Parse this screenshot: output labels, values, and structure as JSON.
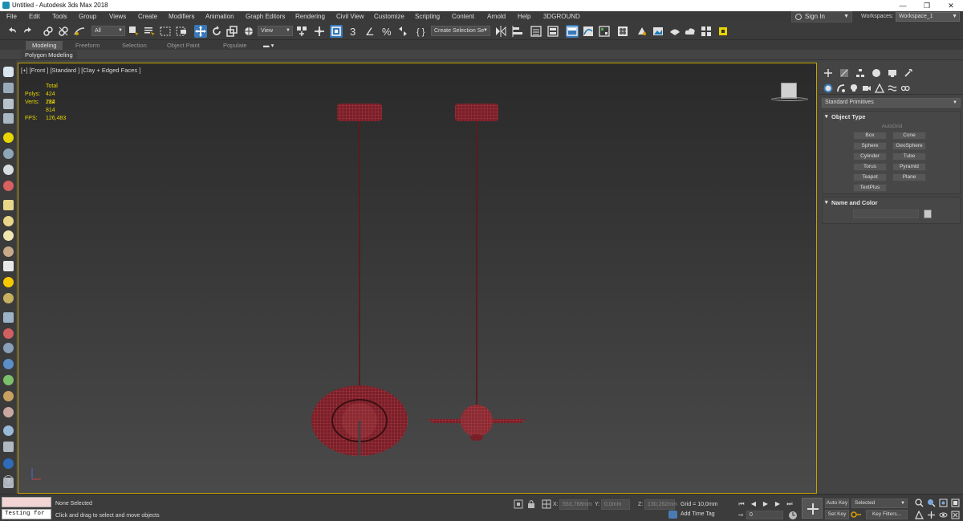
{
  "window": {
    "title": "Untitled - Autodesk 3ds Max 2018",
    "minimize": "—",
    "restore": "❐",
    "close": "✕"
  },
  "menu": [
    "File",
    "Edit",
    "Tools",
    "Group",
    "Views",
    "Create",
    "Modifiers",
    "Animation",
    "Graph Editors",
    "Rendering",
    "Civil View",
    "Customize",
    "Scripting",
    "Content",
    "Arnold",
    "Help",
    "3DGROUND"
  ],
  "account": {
    "sign_in": "Sign In",
    "workspaces_label": "Workspaces:",
    "workspace": "Workspace_1"
  },
  "toolbar": {
    "selection_filter": "All",
    "reference_coord": "View",
    "named_selection": "Create Selection Se",
    "snap_label": "3",
    "angle_snap": "∠",
    "percent_snap": "%"
  },
  "ribbon": {
    "tabs": [
      "Modeling",
      "Freeform",
      "Selection",
      "Object Paint",
      "Populate"
    ],
    "active_tab": "Modeling",
    "panel_label": "Polygon Modeling"
  },
  "viewport": {
    "label": "[+] [Front ] [Standard ] [Clay + Edged Faces ]",
    "stats": {
      "total_label": "Total",
      "polys_label": "Polys:",
      "polys": "424 784",
      "verts_label": "Verts:",
      "verts": "212 814",
      "fps_label": "FPS:",
      "fps": "126,483"
    },
    "mesh_color": "#7a1f28",
    "wire_color": "#c0505a"
  },
  "command_panel": {
    "category": "Standard Primitives",
    "object_type_title": "Object Type",
    "autogrid": "AutoGrid",
    "primitives": [
      "Box",
      "Cone",
      "Sphere",
      "GeoSphere",
      "Cylinder",
      "Tube",
      "Torus",
      "Pyramid",
      "Teapot",
      "Plane",
      "TextPlus"
    ],
    "name_color_title": "Name and Color",
    "name_value": ""
  },
  "status": {
    "maxscript_input": "Testing for :",
    "selection": "None Selected",
    "prompt": "Click and drag to select and move objects",
    "x_label": "X:",
    "x_value": "553,768mm",
    "y_label": "Y:",
    "y_value": "0,0mm",
    "z_label": "Z:",
    "z_value": "130,262mm",
    "grid": "Grid = 10,0mm",
    "add_time_tag": "Add Time Tag",
    "frame": "0",
    "auto_key": "Auto Key",
    "set_key": "Set Key",
    "key_mode": "Selected",
    "key_filters": "Key Filters..."
  }
}
